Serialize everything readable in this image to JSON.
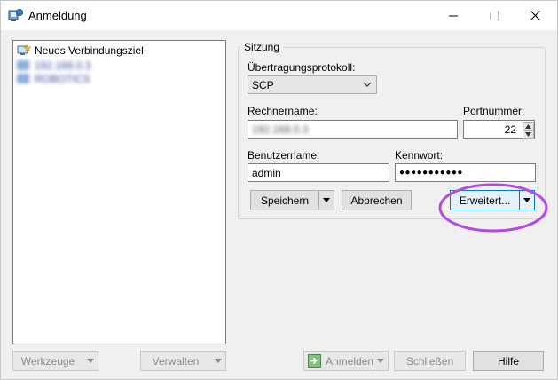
{
  "window": {
    "title": "Anmeldung",
    "controls": {
      "minimize": "—",
      "maximize": "☐",
      "close": "✕"
    }
  },
  "tree": {
    "items": [
      {
        "label": "Neues Verbindungsziel",
        "icon": "new-site-icon"
      },
      {
        "label": "192.168.0.3",
        "icon": "saved-site-icon",
        "obscured": true
      },
      {
        "label": "ROBOTICS",
        "icon": "saved-site-icon",
        "obscured": true
      }
    ]
  },
  "session": {
    "legend": "Sitzung",
    "protocol_label": "Übertragungsprotokoll:",
    "protocol_value": "SCP",
    "host_label": "Rechnername:",
    "host_value": "192.168.0.3",
    "port_label": "Portnummer:",
    "port_value": "22",
    "user_label": "Benutzername:",
    "user_value": "admin",
    "password_label": "Kennwort:",
    "password_value": "●●●●●●●●●●●",
    "save_label": "Speichern",
    "cancel_label": "Abbrechen",
    "advanced_label": "Erweitert..."
  },
  "footer": {
    "tools_label": "Werkzeuge",
    "manage_label": "Verwalten",
    "login_label": "Anmelden",
    "close_label": "Schließen",
    "help_label": "Hilfe"
  },
  "colors": {
    "annotation_ring": "#b44be0",
    "focus_border": "#0078d7",
    "window_bg": "#f0f0f0"
  }
}
